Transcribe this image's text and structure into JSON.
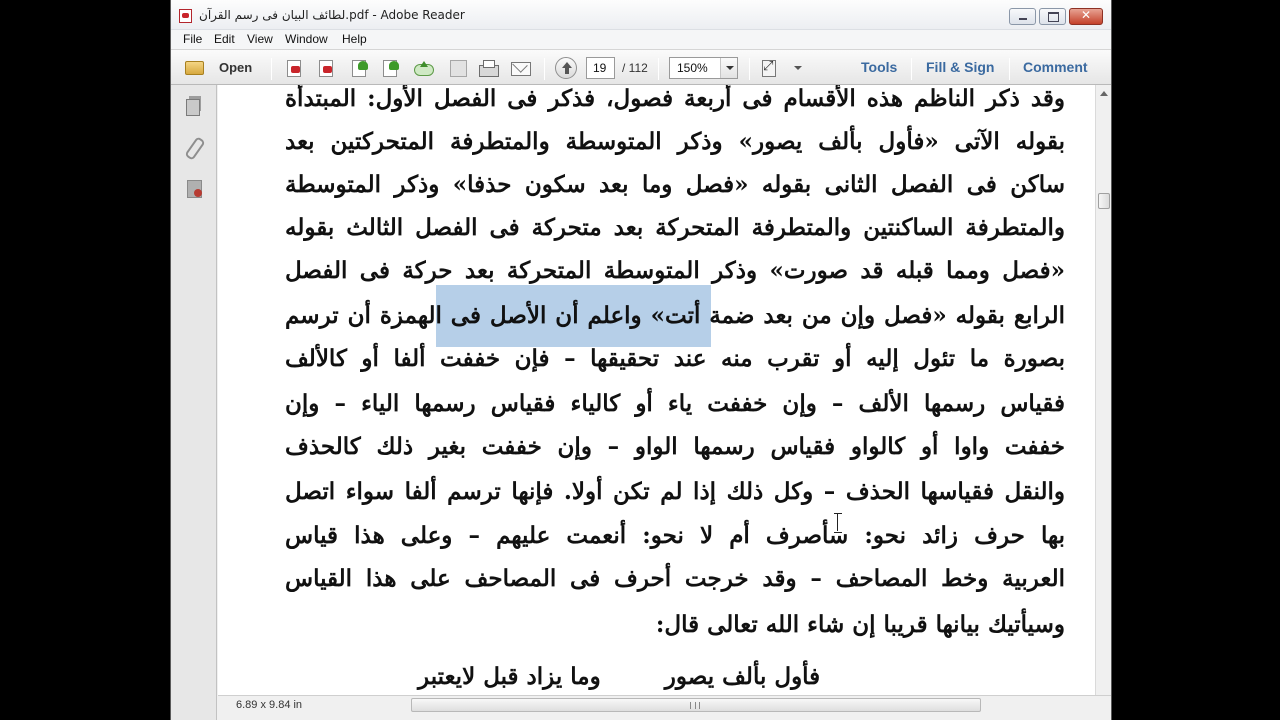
{
  "window": {
    "title": "لطائف البيان فى رسم القرآن.pdf - Adobe Reader",
    "close_glyph": "✕"
  },
  "menu": [
    "File",
    "Edit",
    "View",
    "Window",
    "Help"
  ],
  "toolbar": {
    "open_label": "Open",
    "current_page": "19",
    "total_pages": "/ 112",
    "zoom": "150%",
    "tools_label": "Tools",
    "fill_sign_label": "Fill & Sign",
    "comment_label": "Comment",
    "icons": [
      "create-pdf-icon",
      "export-pdf-icon",
      "edit-icon",
      "share-icon",
      "cloud-upload-icon",
      "save-icon",
      "print-icon",
      "email-icon",
      "previous-page-icon",
      "fit-page-icon"
    ]
  },
  "document": {
    "lines": [
      "وقد ذكر الناظم هذه الأقسام فى أربعة فصول، فذكر فى الفصل الأول: المبتدأة",
      "بقوله الآتى «فأول بألف يصور» وذكر المتوسطة والمتطرفة المتحركتين بعد",
      "ساكن فى الفصل الثانى بقوله «فصل وما بعد سكون حذفا» وذكر المتوسطة",
      "والمتطرفة الساكنتين والمتطرفة المتحركة بعد متحركة فى الفصل الثالث بقوله",
      "«فصل ومما قبله قد صورت» وذكر المتوسطة المتحركة بعد حركة فى الفصل",
      "الرابع بقوله «فصل وإن من بعد ضمة أتت» واعلم أن الأصل فى الهمزة أن ترسم",
      "بصورة ما تئول إليه أو تقرب منه عند تحقيقها – فإن خففت ألفا أو كالألف",
      "فقياس رسمها الألف – وإن خففت ياء أو كالياء فقياس رسمها الياء – وإن",
      "خففت واوا أو كالواو فقياس رسمها الواو – وإن خففت بغير ذلك كالحذف",
      "والنقل فقياسها الحذف – وكل ذلك إذا لم تكن أولا. فإنها ترسم ألفا سواء اتصل",
      "بها حرف زائد نحو: سأصرف أم لا نحو: أنعمت عليهم – وعلى هذا قياس",
      "العربية وخط المصاحف – وقد خرجت أحرف فى المصاحف على هذا القياس",
      "وسيأتيك بيانها قريبا إن شاء الله تعالى قال:"
    ],
    "poem": "فأول بألف يصور        وما يزاد قبل لايعتبر",
    "selected_text": "واعلم أن الأصل فى الهمزة"
  },
  "status": {
    "page_size": "6.89 x 9.84 in"
  }
}
